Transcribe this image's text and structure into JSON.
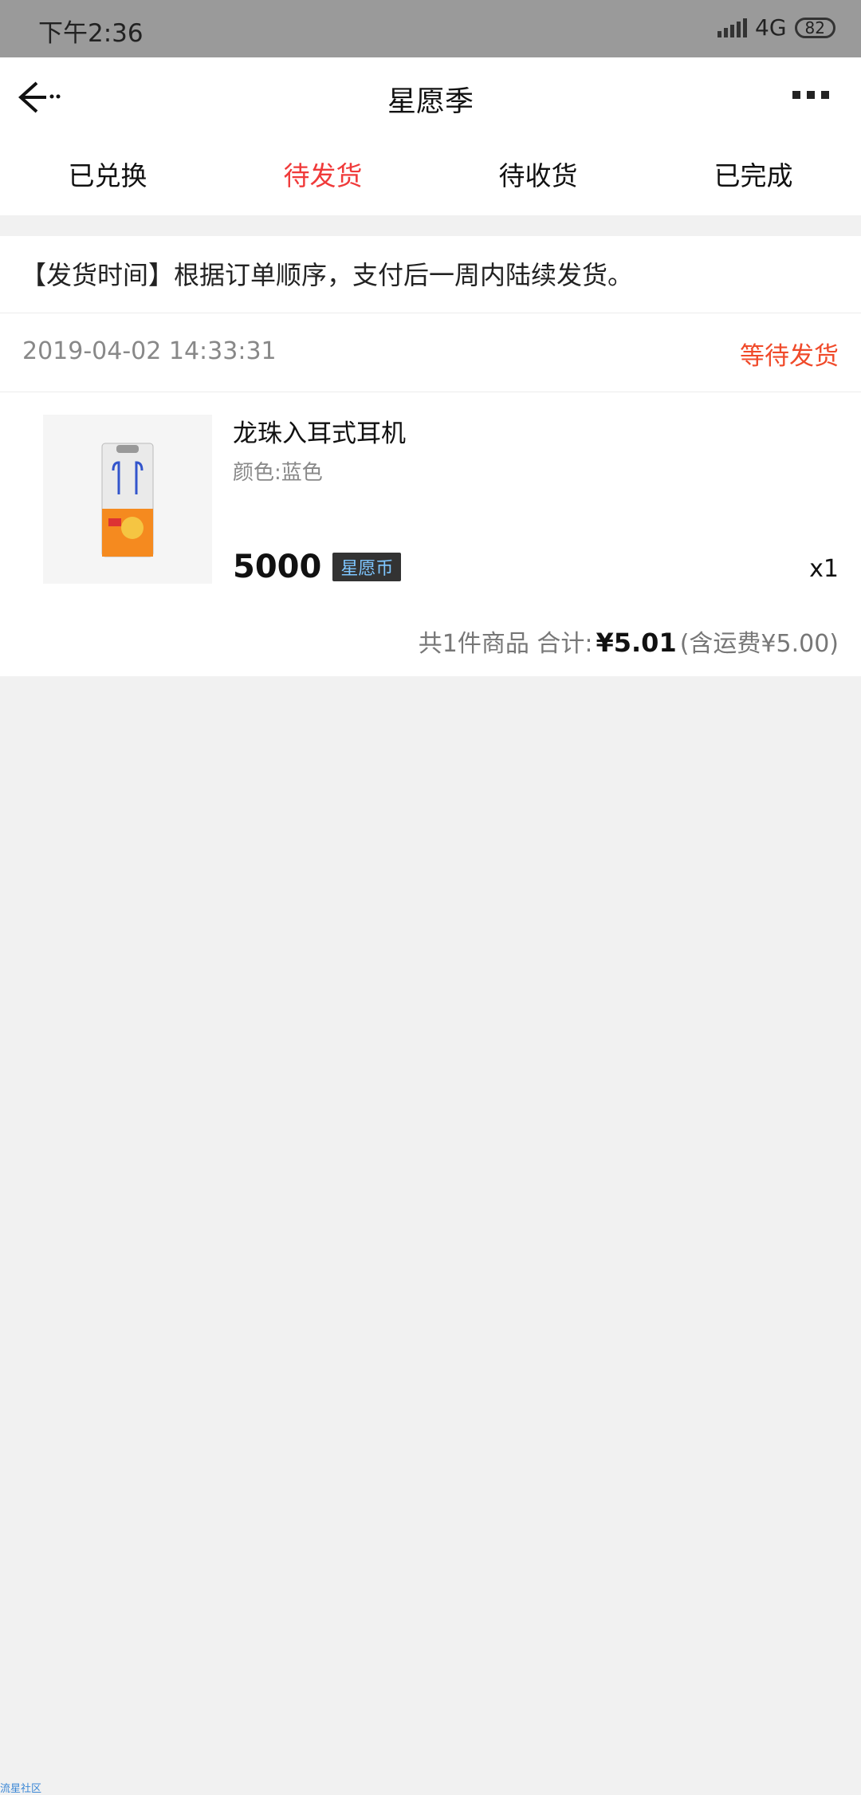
{
  "status_bar": {
    "time": "下午2:36",
    "network": "4G",
    "battery": "82"
  },
  "nav": {
    "title": "星愿季"
  },
  "tabs": [
    {
      "label": "已兑换",
      "active": false
    },
    {
      "label": "待发货",
      "active": true
    },
    {
      "label": "待收货",
      "active": false
    },
    {
      "label": "已完成",
      "active": false
    }
  ],
  "notice": {
    "text": "【发货时间】根据订单顺序，支付后一周内陆续发货。"
  },
  "order": {
    "date": "2019-04-02 14:33:31",
    "status": "等待发货",
    "product_name": "龙珠入耳式耳机",
    "product_spec": "颜色:蓝色",
    "price": "5000",
    "currency_badge": "星愿币",
    "quantity": "x1",
    "summary_prefix": "共1件商品 合计:",
    "total": "¥5.01",
    "shipping_note": "(含运费¥5.00)"
  },
  "footer": {
    "watermark": "流星社区"
  },
  "colors": {
    "accent_red": "#f03a3a",
    "status_orange": "#f04a2a",
    "badge_text": "#7ec6ff"
  }
}
